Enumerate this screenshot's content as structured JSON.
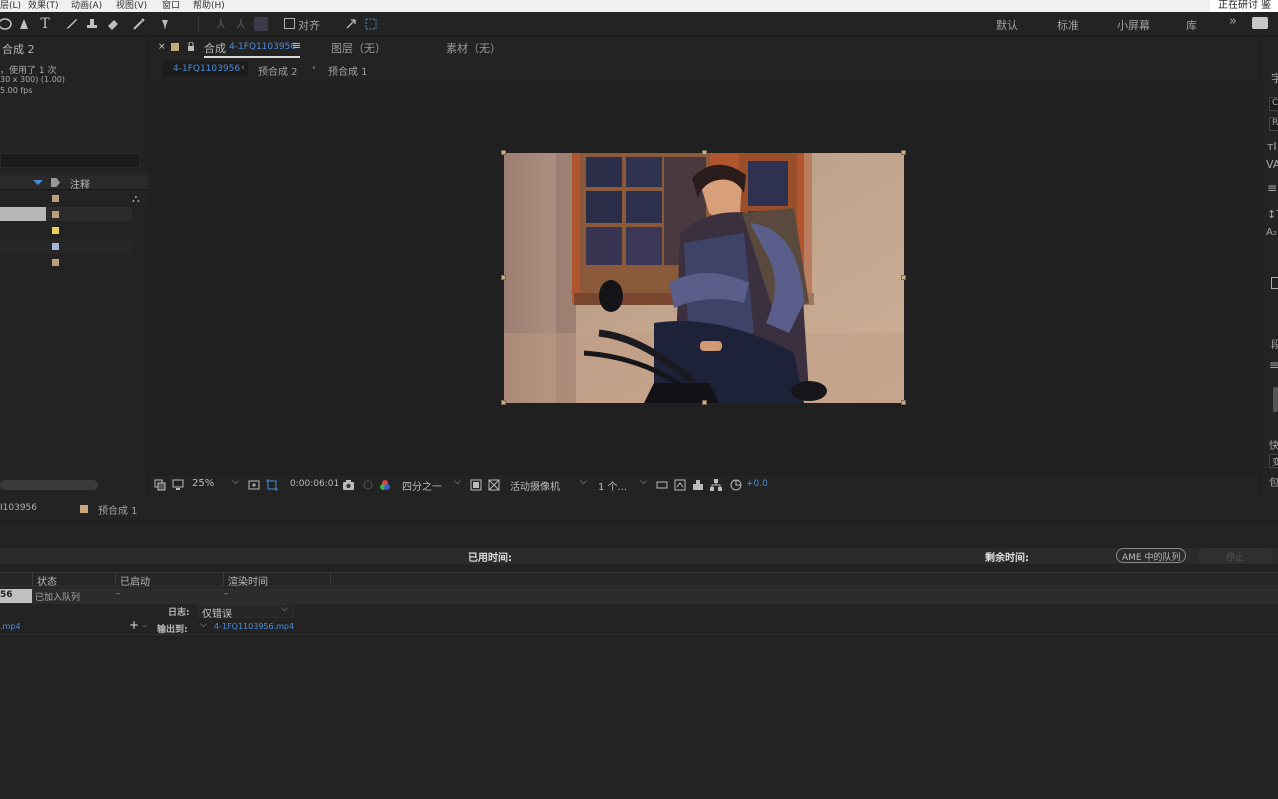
{
  "menu": {
    "items": [
      "层(L)",
      "效果(T)",
      "动画(A)",
      "视图(V)",
      "窗口",
      "帮助(H)"
    ],
    "top_right_text": "正在研讨 鉴"
  },
  "toolbar": {
    "align_label": "对齐",
    "workspaces": [
      "默认",
      "标准",
      "小屏幕",
      "库"
    ],
    "more": "»"
  },
  "project": {
    "comp_name": "合成 2",
    "info_line1": "，使用了 1 次",
    "info_line2": "30 x 300) (1.00)",
    "info_line3": "5.00 fps",
    "col_comment": "注释",
    "rows": [
      {
        "label_color": "#b8a07a"
      },
      {
        "label_color": "#b8a07a"
      },
      {
        "label_color": "#e8cc5c"
      },
      {
        "label_color": "#a9b4d8"
      },
      {
        "label_color": "#b8a07a"
      }
    ]
  },
  "viewer": {
    "tab_comp_prefix": "合成",
    "tab_comp_name": "4-1FQ1103956",
    "tab_layer": "图层（无）",
    "tab_footage": "素材（无）",
    "breadcrumbs": [
      "4-1FQ1103956",
      "预合成 2",
      "预合成 1"
    ]
  },
  "viewbar": {
    "zoom": "25%",
    "timecode": "0:00:06:01",
    "resolution": "四分之一",
    "camera": "活动摄像机",
    "views": "1 个...",
    "exposure": "+0.0"
  },
  "right_panel": {
    "letters": [
      "字",
      "C",
      "R",
      "段",
      "快",
      "变",
      "包"
    ]
  },
  "render_queue": {
    "tabs": [
      "I103956",
      "预合成 1"
    ],
    "elapsed_label": "已用时间:",
    "remaining_label": "剩余时间:",
    "ame_button": "AME 中的队列",
    "stop_button": "停止",
    "col_status": "状态",
    "col_started": "已启动",
    "col_render_time": "渲染时间",
    "item_num": "56",
    "item_status": "已加入队列",
    "item_started": "–",
    "item_render_time": "–",
    "log_label": "日志:",
    "log_value": "仅错误",
    "output_label": "输出到:",
    "output_file": "4-1FQ1103956.mp4",
    "output_module_file": ".mp4"
  }
}
